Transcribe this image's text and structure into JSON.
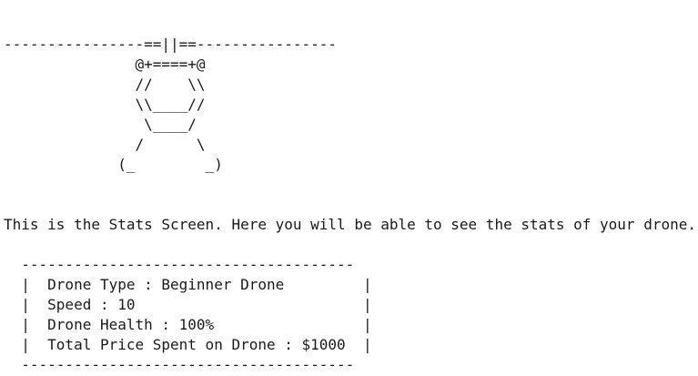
{
  "art": {
    "lines": [
      "----------------==||==----------------",
      "               @+====+@",
      "               //    \\\\",
      "               \\\\____//",
      "                \\____/",
      "               /      \\",
      "             (_        _)"
    ]
  },
  "intro_text": "This is the Stats Screen. Here you will be able to see the stats of your drone.",
  "stats_box": {
    "border_top": "  --------------------------------------",
    "rows": [
      "  |  Drone Type : Beginner Drone         |",
      "  |  Speed : 10                          |",
      "  |  Drone Health : 100%                 |",
      "  |  Total Price Spent on Drone : $1000  |"
    ],
    "border_bottom": "  --------------------------------------"
  }
}
